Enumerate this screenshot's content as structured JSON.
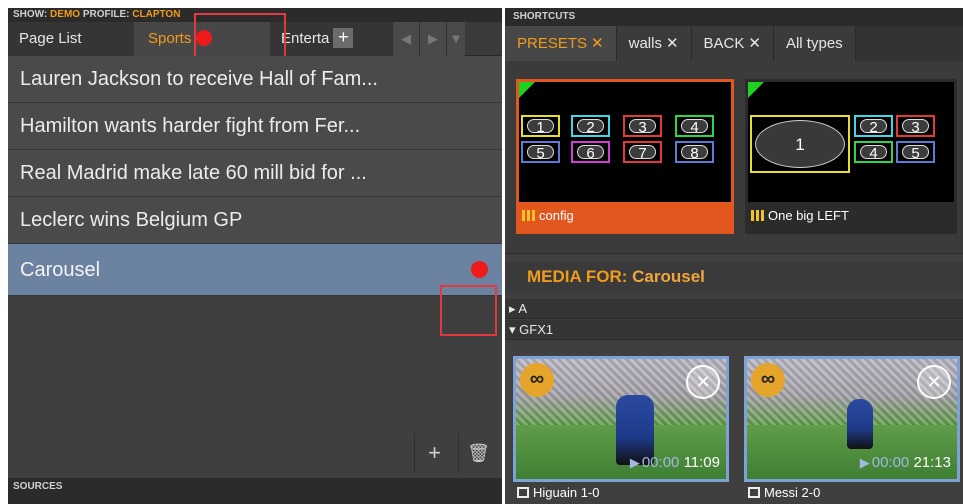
{
  "show_bar": {
    "show_label": "SHOW:",
    "show_value": "DEMO",
    "profile_label": "PROFILE:",
    "profile_value": "CLAPTON"
  },
  "page_tabs": {
    "items": [
      {
        "label": "Page List"
      },
      {
        "label": "Sports",
        "has_dot": true
      },
      {
        "label": "Enterta"
      }
    ],
    "add_icon": "plus-icon",
    "prev_icon": "triangle-left-icon",
    "next_icon": "triangle-right-icon",
    "menu_icon": "triangle-down-icon"
  },
  "page_list": [
    {
      "title": "Lauren Jackson to receive Hall of Fam..."
    },
    {
      "title": "Hamilton wants harder fight from Fer..."
    },
    {
      "title": "Real Madrid make late 60 mill bid for ..."
    },
    {
      "title": "Leclerc wins Belgium GP"
    },
    {
      "title": "Carousel",
      "selected": true,
      "has_dot": true
    }
  ],
  "list_tools": {
    "add_icon": "plus-icon",
    "delete_icon": "trash-icon"
  },
  "sources_label": "SOURCES",
  "shortcuts": {
    "label": "SHORTCUTS",
    "tabs": [
      {
        "label": "PRESETS",
        "active": true
      },
      {
        "label": "walls"
      },
      {
        "label": "BACK"
      },
      {
        "label": "All types"
      }
    ],
    "close_glyph": "✕"
  },
  "presets": [
    {
      "label": "config",
      "cells": [
        "1",
        "2",
        "3",
        "4",
        "5",
        "6",
        "7",
        "8"
      ]
    },
    {
      "label": "One big LEFT",
      "cells": [
        "1",
        "2",
        "3",
        "4",
        "5"
      ]
    }
  ],
  "media": {
    "title_prefix": "MEDIA FOR:",
    "title_value": "Carousel",
    "groups": [
      {
        "label": "A",
        "expanded": false
      },
      {
        "label": "GFX1",
        "expanded": true
      }
    ],
    "items": [
      {
        "name": "Higuain 1-0",
        "elapsed": "00:00",
        "duration": "11:09"
      },
      {
        "name": "Messi 2-0",
        "elapsed": "00:00",
        "duration": "21:13"
      }
    ]
  },
  "colors": {
    "accent": "#f29a1b",
    "selected_row": "#6b82a1",
    "live_dot": "#ee1b1b",
    "preset_active": "#e2571e",
    "highlight_box": "#e0393e"
  }
}
